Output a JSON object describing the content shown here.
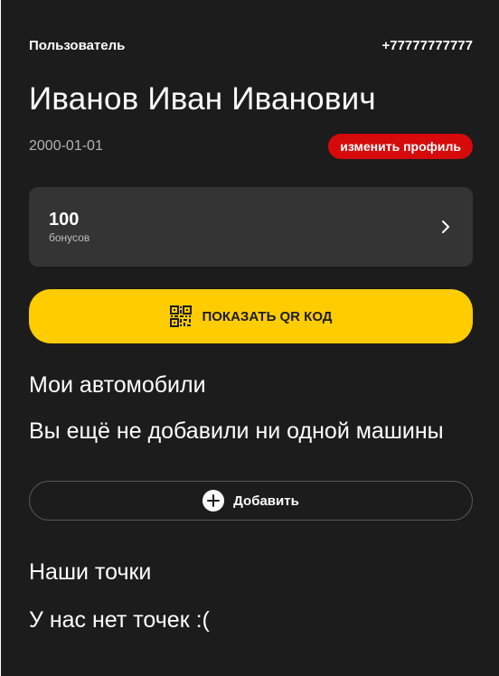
{
  "header": {
    "user_label": "Пользователь",
    "phone": "+77777777777"
  },
  "profile": {
    "full_name": "Иванов Иван Иванович",
    "birth_date": "2000-01-01",
    "edit_label": "изменить профиль"
  },
  "bonus": {
    "value": "100",
    "label": "бонусов"
  },
  "qr": {
    "label": "ПОКАЗАТЬ QR КОД",
    "icon": "qr-code-icon"
  },
  "cars": {
    "title": "Мои автомобили",
    "empty_text": "Вы ещё не добавили ни одной машины",
    "add_label": "Добавить",
    "add_icon": "plus-circle-icon"
  },
  "points": {
    "title": "Наши точки",
    "empty_text": "У нас нет точек :("
  },
  "colors": {
    "background": "#1c1c1c",
    "card": "#343434",
    "accent_yellow": "#ffcc00",
    "accent_red": "#d60a0a"
  }
}
